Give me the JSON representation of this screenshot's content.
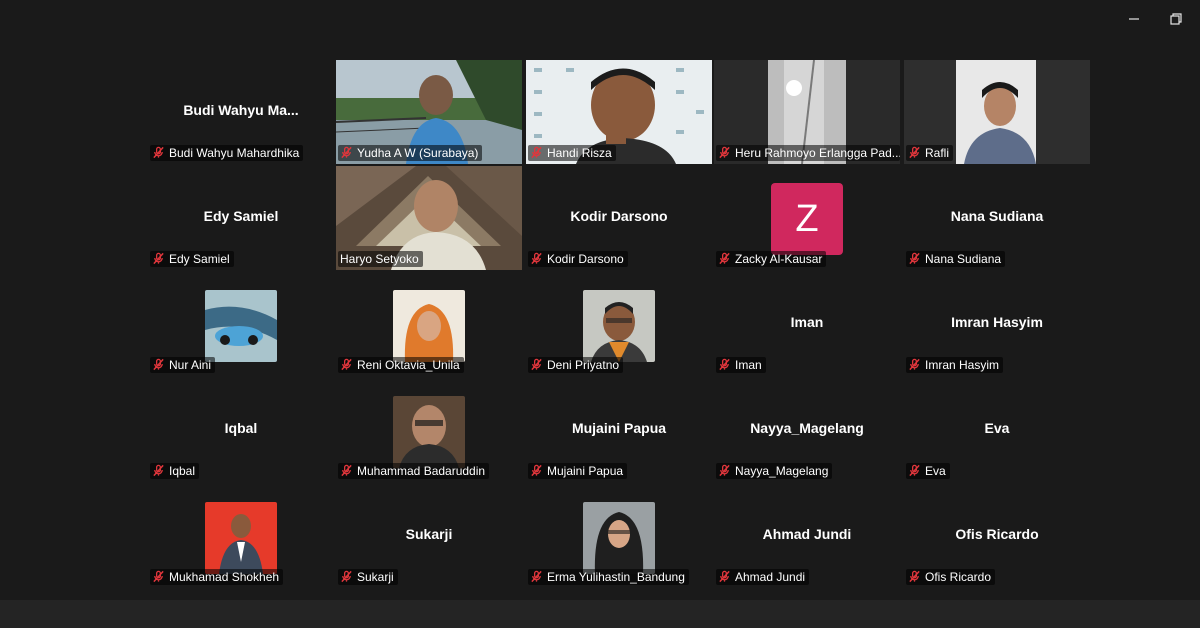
{
  "window": {
    "minimize_icon": "minimize-icon",
    "restore_icon": "restore-icon"
  },
  "participants": {
    "budi_big": "Budi  Wahyu  Ma...",
    "budi": "Budi Wahyu Mahardhika",
    "yudha": "Yudha A W (Surabaya)",
    "handi": "Handi Risza",
    "heru": "Heru Rahmoyo Erlangga Pad...",
    "rafli": "Rafli",
    "edy_big": "Edy Samiel",
    "edy": "Edy Samiel",
    "haryo": "Haryo Setyoko",
    "kodir_big": "Kodir Darsono",
    "kodir": "Kodir Darsono",
    "zacky_initial": "Z",
    "zacky": "Zacky Al-Kausar",
    "nana_big": "Nana Sudiana",
    "nana": "Nana Sudiana",
    "nur": "Nur Aini",
    "reni": "Reni Oktavia_Unila",
    "deni": "Deni Priyatno",
    "iman_big": "Iman",
    "iman": "Iman",
    "imran_big": "Imran Hasyim",
    "imran": "Imran Hasyim",
    "iqbal_big": "Iqbal",
    "iqbal": "Iqbal",
    "muhammad": "Muhammad Badaruddin",
    "mujaini_big": "Mujaini Papua",
    "mujaini": "Mujaini Papua",
    "nayya_big": "Nayya_Magelang",
    "nayya": "Nayya_Magelang",
    "eva_big": "Eva",
    "eva": "Eva",
    "mukhamad": "Mukhamad Shokheh",
    "sukarji_big": "Sukarji",
    "sukarji": "Sukarji",
    "erma": "Erma Yulihastin_Bandung",
    "ahmad_big": "Ahmad Jundi",
    "ahmad": "Ahmad Jundi",
    "ofis_big": "Ofis Ricardo",
    "ofis": "Ofis Ricardo"
  },
  "colors": {
    "active_speaker": "#2fbf71",
    "mute_icon": "#e0363c",
    "zacky_avatar": "#d0285e"
  }
}
